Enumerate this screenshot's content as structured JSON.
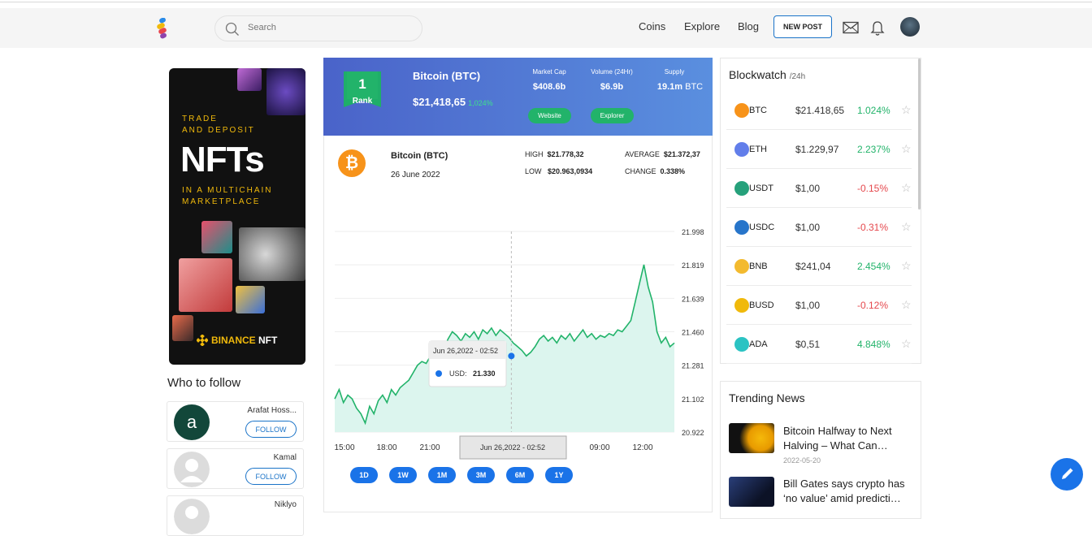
{
  "header": {
    "search_placeholder": "Search",
    "nav": [
      "Coins",
      "Explore",
      "Blog"
    ],
    "new_post": "NEW POST"
  },
  "ad": {
    "line1": "TRADE",
    "line2": "AND DEPOSIT",
    "headline": "NFTs",
    "line3": "IN A MULTICHAIN",
    "line4": "MARKETPLACE",
    "brand": "BINANCE",
    "brand_suffix": "NFT"
  },
  "who_to_follow": {
    "title": "Who to follow",
    "people": [
      {
        "name": "Arafat Hoss...",
        "initial": "a",
        "button": "FOLLOW"
      },
      {
        "name": "Kamal",
        "initial": "",
        "button": "FOLLOW"
      },
      {
        "name": "Niklyo",
        "initial": "",
        "button": ""
      }
    ]
  },
  "coin": {
    "rank": "1",
    "rank_label": "Rank",
    "name": "Bitcoin (BTC)",
    "price": "$21,418,65",
    "change": "1,024%",
    "market_cap_label": "Market Cap",
    "market_cap": "$408.6b",
    "volume_label": "Volume (24Hr)",
    "volume": "$6.9b",
    "supply_label": "Supply",
    "supply": "19.1m",
    "supply_unit": "BTC",
    "website_btn": "Website",
    "explorer_btn": "Explorer",
    "date": "26 June 2022",
    "high_label": "HIGH",
    "high": "$21.778,32",
    "low_label": "LOW",
    "low": "$20.963,0934",
    "average_label": "AVERAGE",
    "average": "$21.372,37",
    "change_label": "CHANGE",
    "change_value": "0.338%"
  },
  "chart_data": {
    "type": "area",
    "x_ticks": [
      "15:00",
      "18:00",
      "21:00",
      "",
      "",
      "09:00",
      "12:00"
    ],
    "y_ticks": [
      "21.998",
      "21.819",
      "21.639",
      "21.460",
      "21.281",
      "21.102",
      "20.922"
    ],
    "ylim": [
      20.922,
      21.998
    ],
    "values": [
      21.1,
      21.15,
      21.08,
      21.12,
      21.1,
      21.05,
      21.02,
      20.97,
      21.06,
      21.02,
      21.09,
      21.12,
      21.08,
      21.15,
      21.12,
      21.16,
      21.18,
      21.2,
      21.24,
      21.28,
      21.3,
      21.29,
      21.33,
      21.32,
      21.3,
      21.36,
      21.42,
      21.46,
      21.44,
      21.41,
      21.45,
      21.43,
      21.46,
      21.42,
      21.47,
      21.45,
      21.48,
      21.44,
      21.47,
      21.45,
      21.43,
      21.4,
      21.38,
      21.36,
      21.33,
      21.35,
      21.38,
      21.42,
      21.44,
      21.41,
      21.43,
      21.4,
      21.44,
      21.42,
      21.45,
      21.41,
      21.44,
      21.47,
      21.43,
      21.45,
      21.42,
      21.44,
      21.43,
      21.45,
      21.44,
      21.47,
      21.46,
      21.49,
      21.52,
      21.62,
      21.72,
      21.82,
      21.7,
      21.62,
      21.46,
      21.4,
      21.43,
      21.38,
      21.4
    ],
    "tooltip_date": "Jun 26,2022 - 02:52",
    "tooltip_label": "USD:",
    "tooltip_value": "21.330",
    "crosshair_label": "Jun 26,2022 - 02:52",
    "colors": {
      "line": "#22b36a",
      "fill": "#dcf5ee",
      "marker": "#1a73e8"
    }
  },
  "ranges": [
    "1D",
    "1W",
    "1M",
    "3M",
    "6M",
    "1Y"
  ],
  "blockwatch": {
    "title": "Blockwatch",
    "period": "/24h",
    "rows": [
      {
        "sym": "BTC",
        "price": "$21.418,65",
        "change": "1.024%",
        "up": true,
        "color": "#f7931a"
      },
      {
        "sym": "ETH",
        "price": "$1.229,97",
        "change": "2.237%",
        "up": true,
        "color": "#627eea"
      },
      {
        "sym": "USDT",
        "price": "$1,00",
        "change": "-0.15%",
        "up": false,
        "color": "#26a17b"
      },
      {
        "sym": "USDC",
        "price": "$1,00",
        "change": "-0.31%",
        "up": false,
        "color": "#2775ca"
      },
      {
        "sym": "BNB",
        "price": "$241,04",
        "change": "2.454%",
        "up": true,
        "color": "#f3ba2f"
      },
      {
        "sym": "BUSD",
        "price": "$1,00",
        "change": "-0.12%",
        "up": false,
        "color": "#f0b90b"
      },
      {
        "sym": "ADA",
        "price": "$0,51",
        "change": "4.848%",
        "up": true,
        "color": "#2bc3c3"
      }
    ]
  },
  "trending": {
    "title": "Trending News",
    "items": [
      {
        "headline1": "Bitcoin Halfway to Next",
        "headline2": "Halving – What Can…",
        "date": "2022-05-20"
      },
      {
        "headline1": "Bill Gates says crypto has",
        "headline2": "‘no value’ amid predicti…",
        "date": ""
      }
    ]
  }
}
